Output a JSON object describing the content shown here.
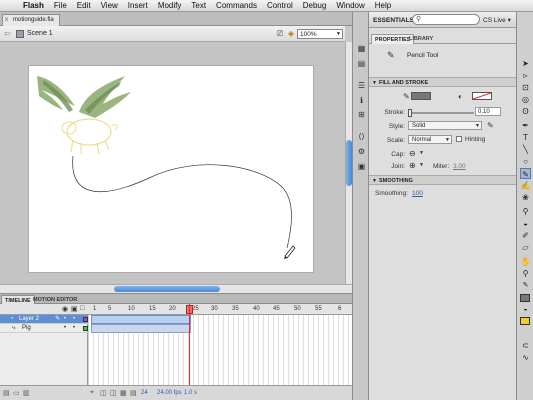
{
  "menubar": {
    "apple_glyph": "",
    "items": [
      "Flash",
      "File",
      "Edit",
      "View",
      "Insert",
      "Modify",
      "Text",
      "Commands",
      "Control",
      "Debug",
      "Window",
      "Help"
    ]
  },
  "document": {
    "tab_name": "motionguide.fla",
    "close_glyph": "x",
    "scene_label": "Scene 1",
    "zoom": "100%"
  },
  "timeline": {
    "tabs": [
      "TIMELINE",
      "MOTION EDITOR"
    ],
    "frame_numbers": [
      "1",
      "5",
      "10",
      "15",
      "20",
      "25",
      "30",
      "35",
      "40",
      "45",
      "50",
      "55",
      "6"
    ],
    "layers": [
      {
        "name": "Layer 2",
        "selected": true,
        "color": "#9a4fd0"
      },
      {
        "name": "Pig",
        "selected": false,
        "color": "#3fcf3f"
      }
    ],
    "footer": {
      "current_frame": "24",
      "fps": "24.00 fps",
      "elapsed": "1.0 s"
    }
  },
  "workspace": {
    "essentials": "ESSENTIALS ▾",
    "search_placeholder": "",
    "cs_live": "CS Live ▾"
  },
  "properties": {
    "tabs": [
      "PROPERTIES",
      "LIBRARY"
    ],
    "tool_name": "Pencil Tool",
    "sections": {
      "fill_and_stroke": "FILL AND STROKE",
      "smoothing": "SMOOTHING"
    },
    "stroke_label": "Stroke:",
    "stroke_value": "0.10",
    "style_label": "Style:",
    "style_value": "Solid",
    "scale_label": "Scale:",
    "scale_value": "Normal",
    "hinting_label": "Hinting",
    "cap_label": "Cap:",
    "join_label": "Join:",
    "miter_label": "Miter:",
    "miter_value": "3.00",
    "smoothing_label": "Smoothing:",
    "smoothing_value": "100"
  },
  "colors": {
    "stroke_swatch": "#777777",
    "fill_swatch": "#f0d02a",
    "selection_blue": "#5d8fd6"
  }
}
